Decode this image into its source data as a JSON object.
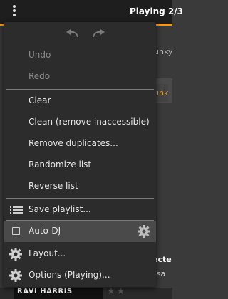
{
  "header": {
    "title": "Playing 2/3"
  },
  "background": {
    "track_1": "unky",
    "track_2": "unk",
    "heading": "ecte",
    "subtext": "ssa",
    "album_art_text": "RAVI HARRIS",
    "stars": "★★"
  },
  "menu": {
    "undo_label": "Undo",
    "redo_label": "Redo",
    "clear_label": "Clear",
    "clean_label": "Clean (remove inaccessible)",
    "remove_duplicates_label": "Remove duplicates...",
    "randomize_label": "Randomize list",
    "reverse_label": "Reverse list",
    "save_playlist_label": "Save playlist...",
    "auto_dj_label": "Auto-DJ",
    "layout_label": "Layout...",
    "options_label": "Options (Playing)..."
  },
  "colors": {
    "accent": "#ff9800",
    "menu_bg": "#2c2c2c",
    "highlight": "#4a4a4a"
  },
  "icons": {
    "undo": "undo-icon",
    "redo": "redo-icon",
    "list": "list-icon",
    "checkbox": "checkbox-icon",
    "gear": "gear-icon"
  }
}
